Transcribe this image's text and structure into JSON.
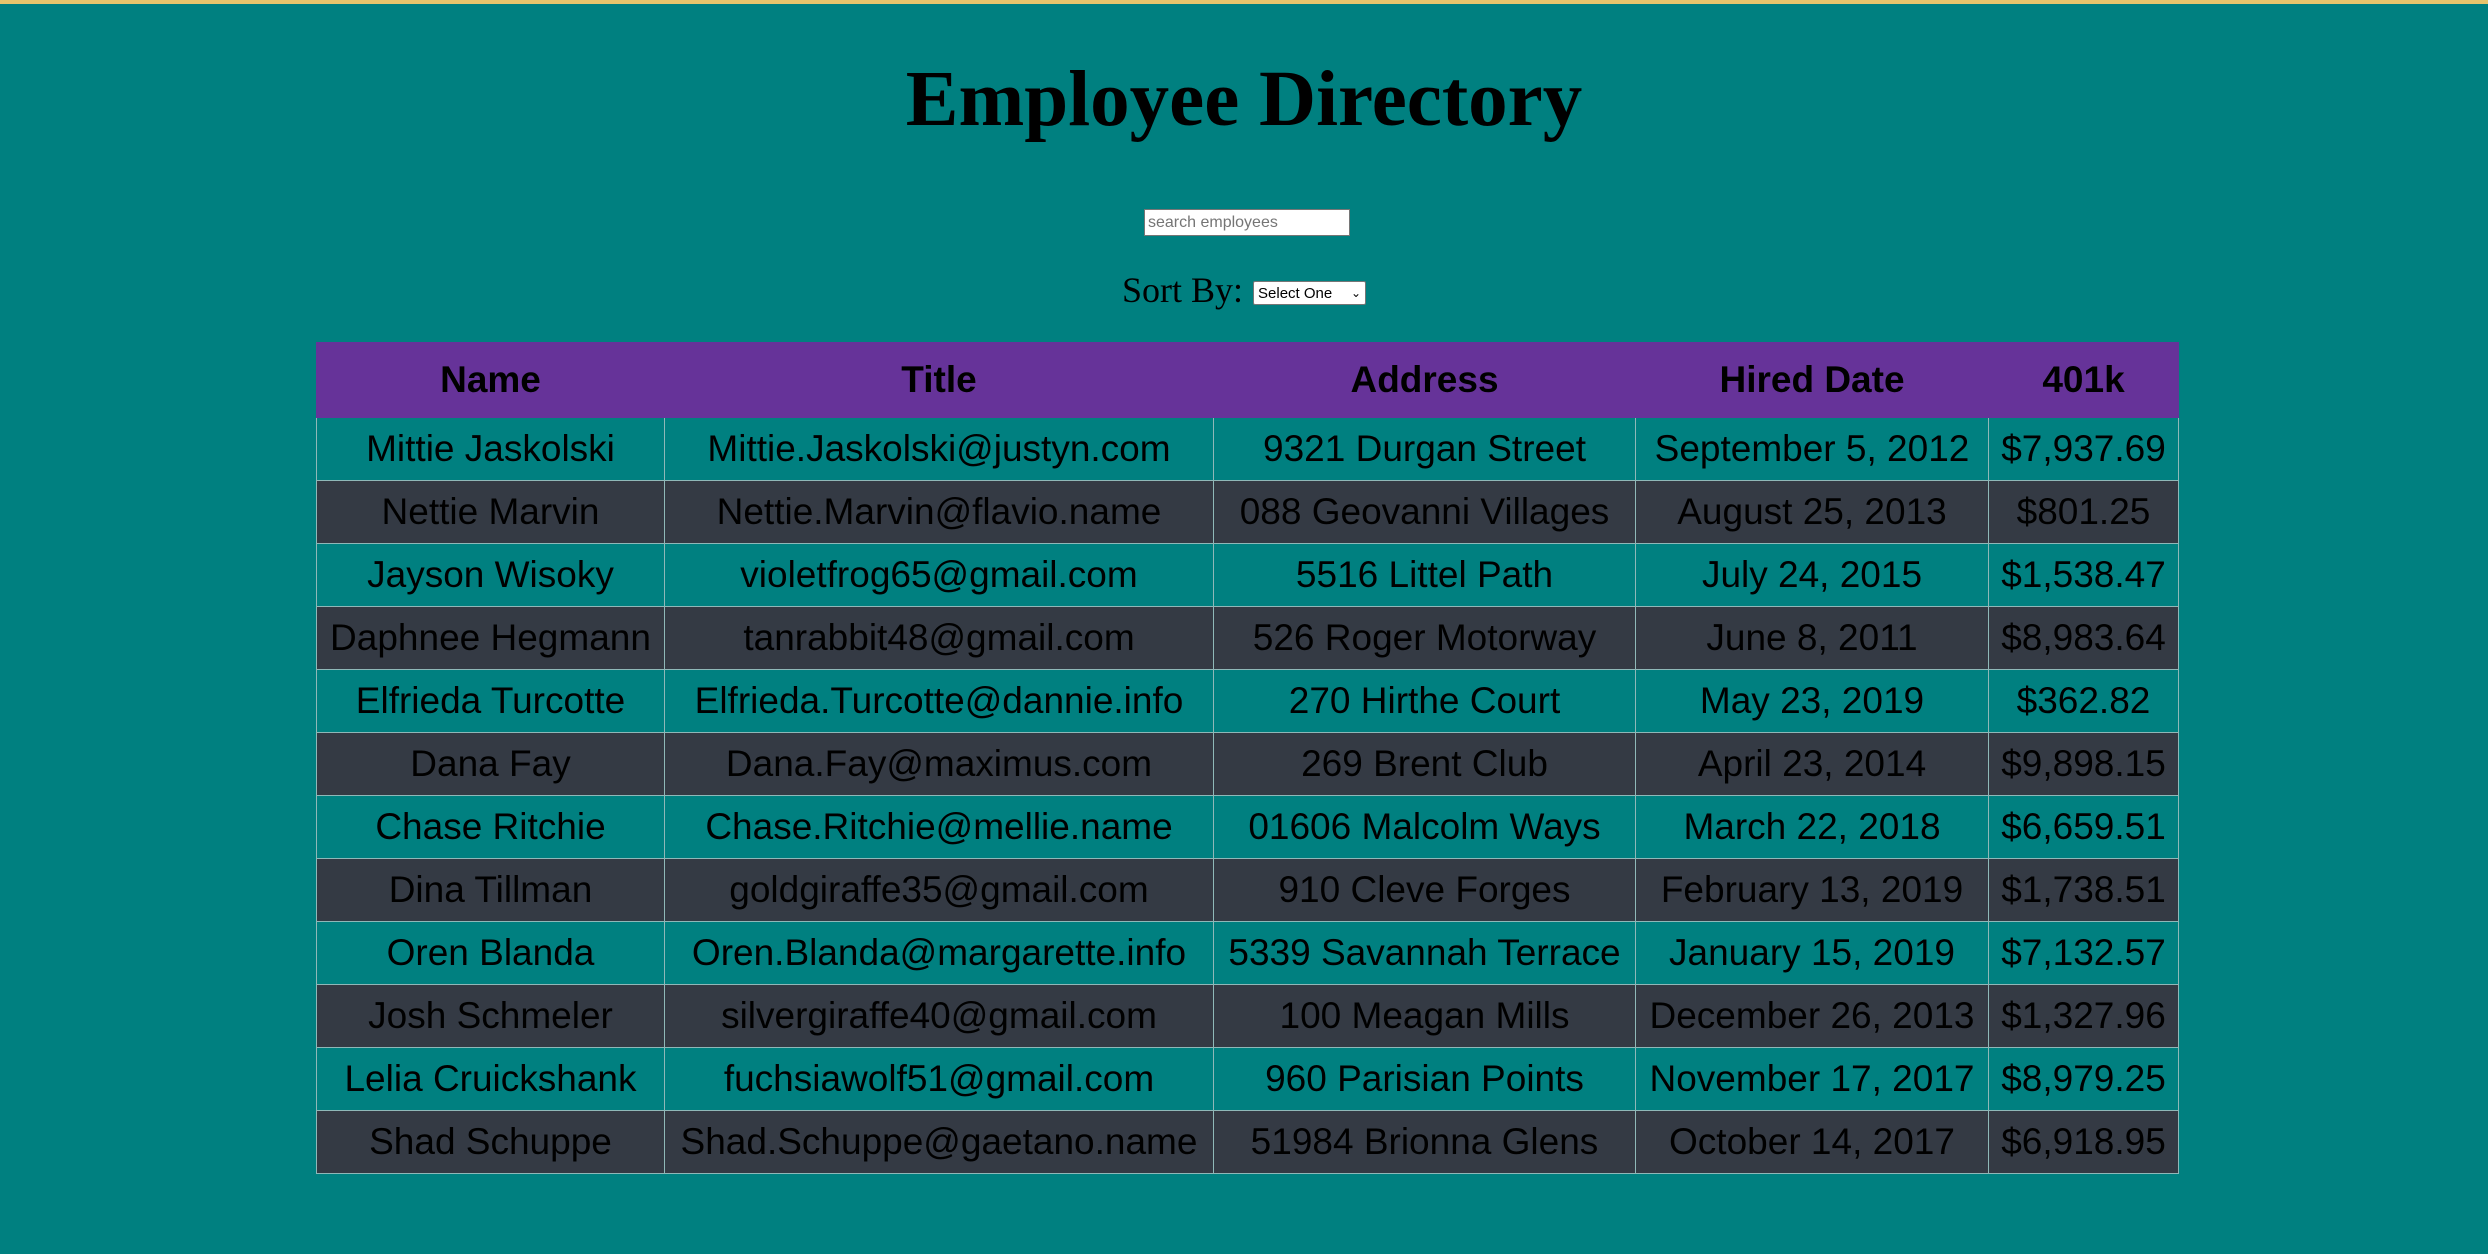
{
  "header": {
    "title": "Employee Directory"
  },
  "search": {
    "placeholder": "search employees",
    "value": ""
  },
  "sort": {
    "label": "Sort By:",
    "selected": "Select One"
  },
  "table": {
    "columns": [
      "Name",
      "Title",
      "Address",
      "Hired Date",
      "401k"
    ],
    "rows": [
      [
        "Mittie Jaskolski",
        "Mittie.Jaskolski@justyn.com",
        "9321 Durgan Street",
        "September 5, 2012",
        "$7,937.69"
      ],
      [
        "Nettie Marvin",
        "Nettie.Marvin@flavio.name",
        "088 Geovanni Villages",
        "August 25, 2013",
        "$801.25"
      ],
      [
        "Jayson Wisoky",
        "violetfrog65@gmail.com",
        "5516 Littel Path",
        "July 24, 2015",
        "$1,538.47"
      ],
      [
        "Daphnee Hegmann",
        "tanrabbit48@gmail.com",
        "526 Roger Motorway",
        "June 8, 2011",
        "$8,983.64"
      ],
      [
        "Elfrieda Turcotte",
        "Elfrieda.Turcotte@dannie.info",
        "270 Hirthe Court",
        "May 23, 2019",
        "$362.82"
      ],
      [
        "Dana Fay",
        "Dana.Fay@maximus.com",
        "269 Brent Club",
        "April 23, 2014",
        "$9,898.15"
      ],
      [
        "Chase Ritchie",
        "Chase.Ritchie@mellie.name",
        "01606 Malcolm Ways",
        "March 22, 2018",
        "$6,659.51"
      ],
      [
        "Dina Tillman",
        "goldgiraffe35@gmail.com",
        "910 Cleve Forges",
        "February 13, 2019",
        "$1,738.51"
      ],
      [
        "Oren Blanda",
        "Oren.Blanda@margarette.info",
        "5339 Savannah Terrace",
        "January 15, 2019",
        "$7,132.57"
      ],
      [
        "Josh Schmeler",
        "silvergiraffe40@gmail.com",
        "100 Meagan Mills",
        "December 26, 2013",
        "$1,327.96"
      ],
      [
        "Lelia Cruickshank",
        "fuchsiawolf51@gmail.com",
        "960 Parisian Points",
        "November 17, 2017",
        "$8,979.25"
      ],
      [
        "Shad Schuppe",
        "Shad.Schuppe@gaetano.name",
        "51984 Brionna Glens",
        "October 14, 2017",
        "$6,918.95"
      ]
    ]
  },
  "colors": {
    "background": "#008080",
    "header_row": "#663399",
    "alt_row": "#343a44",
    "top_strip": "#e8c46c"
  }
}
